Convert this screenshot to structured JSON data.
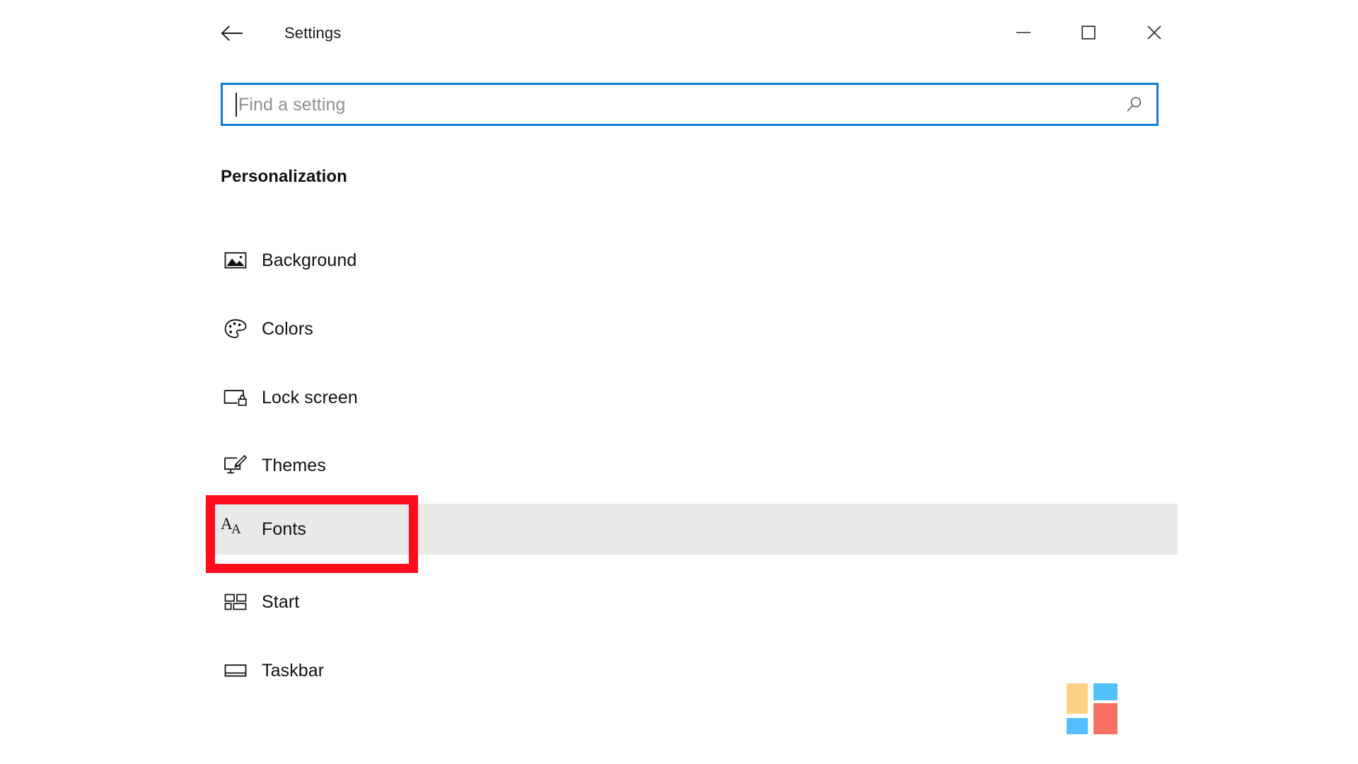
{
  "window": {
    "title": "Settings",
    "back_icon": "back-arrow-icon",
    "minimize_icon": "minimize-icon",
    "maximize_icon": "maximize-icon",
    "close_icon": "close-icon"
  },
  "search": {
    "placeholder": "Find a setting",
    "value": "",
    "icon": "search-magnifier-icon"
  },
  "page": {
    "heading": "Personalization"
  },
  "settings_list": {
    "items": [
      {
        "label": "Background",
        "icon": "picture-icon",
        "highlighted": false
      },
      {
        "label": "Colors",
        "icon": "palette-icon",
        "highlighted": false
      },
      {
        "label": "Lock screen",
        "icon": "lock-screen-icon",
        "highlighted": false
      },
      {
        "label": "Themes",
        "icon": "brush-monitor-icon",
        "highlighted": false
      },
      {
        "label": "Fonts",
        "icon": "aa-letters-icon",
        "highlighted": true
      },
      {
        "label": "Start",
        "icon": "start-tiles-icon",
        "highlighted": false
      },
      {
        "label": "Taskbar",
        "icon": "taskbar-icon",
        "highlighted": false
      }
    ]
  },
  "annotation": {
    "target_label": "Fonts",
    "border_color": "#FC0D1B"
  },
  "brand_logo": {
    "name": "four-tile-logo",
    "tiles": [
      {
        "position": "top-left",
        "color": "#FFD186"
      },
      {
        "position": "top-right",
        "color": "#54BFFF"
      },
      {
        "position": "bottom-left",
        "color": "#54BFFF"
      },
      {
        "position": "bottom-right",
        "color": "#FA6F63"
      }
    ]
  },
  "colors": {
    "accent": "#0F7CD4",
    "highlight_row": "#E9E9E9",
    "text": "#111111",
    "placeholder": "#919191"
  }
}
